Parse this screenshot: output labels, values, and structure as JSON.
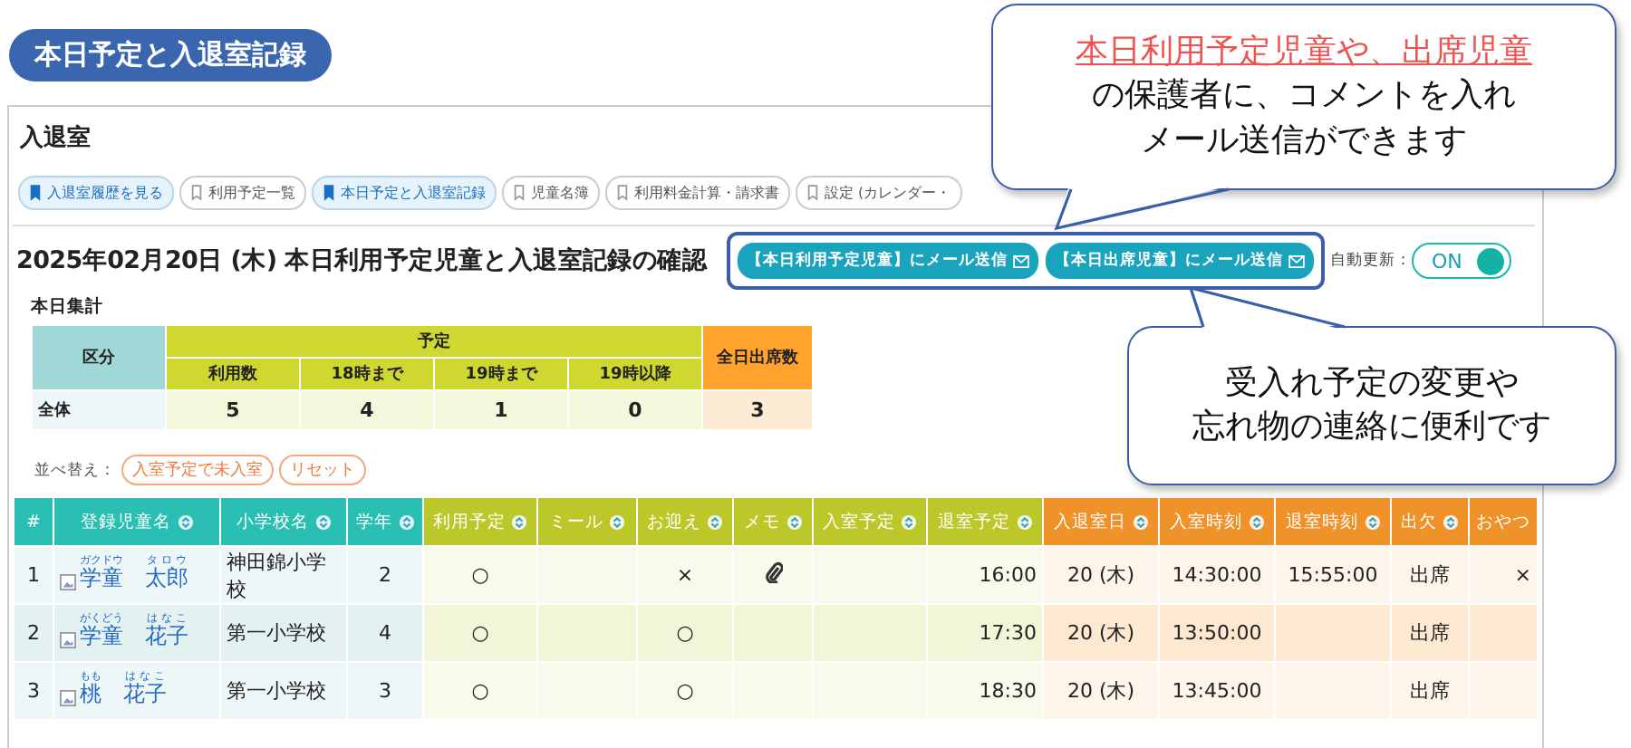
{
  "page_title": "本日予定と入退室記録",
  "panel": {
    "title": "入退室",
    "tabs": [
      {
        "label": "入退室履歴を見る",
        "selected": true
      },
      {
        "label": "利用予定一覧",
        "selected": false
      },
      {
        "label": "本日予定と入退室記録",
        "selected": true
      },
      {
        "label": "児童名簿",
        "selected": false
      },
      {
        "label": "利用料金計算・請求書",
        "selected": false
      },
      {
        "label": "設定 (カレンダー・",
        "selected": false
      }
    ],
    "heading": "2025年02月20日 (木) 本日利用予定児童と入退室記録の確認",
    "mail_buttons": [
      "【本日利用予定児童】にメール送信",
      "【本日出席児童】にメール送信"
    ],
    "auto_update": {
      "label": "自動更新：",
      "toggle_label": "ON",
      "on": true
    },
    "summary": {
      "title": "本日集計",
      "group_header": "区分",
      "plan_header": "予定",
      "plan_columns": [
        "利用数",
        "18時まで",
        "19時まで",
        "19時以降"
      ],
      "total_header": "全日出席数",
      "rows": [
        {
          "label": "全体",
          "values": [
            "5",
            "4",
            "1",
            "0"
          ],
          "total": "3"
        }
      ]
    },
    "sort": {
      "label": "並べ替え：",
      "buttons": [
        "入室予定で未入室",
        "リセット"
      ]
    },
    "table": {
      "columns": [
        {
          "label": "#",
          "color": "#2bbfb3",
          "sortable": false
        },
        {
          "label": "登録児童名",
          "color": "#2bbfb3",
          "sortable": true
        },
        {
          "label": "小学校名",
          "color": "#2bbfb3",
          "sortable": true
        },
        {
          "label": "学年",
          "color": "#2bbfb3",
          "sortable": true
        },
        {
          "label": "利用予定",
          "color": "#bcc72a",
          "sortable": true
        },
        {
          "label": "ミール",
          "color": "#bcc72a",
          "sortable": true
        },
        {
          "label": "お迎え",
          "color": "#bcc72a",
          "sortable": true
        },
        {
          "label": "メモ",
          "color": "#bcc72a",
          "sortable": true
        },
        {
          "label": "入室予定",
          "color": "#bcc72a",
          "sortable": true
        },
        {
          "label": "退室予定",
          "color": "#bcc72a",
          "sortable": true
        },
        {
          "label": "入退室日",
          "color": "#f0922a",
          "sortable": true
        },
        {
          "label": "入室時刻",
          "color": "#f0922a",
          "sortable": true
        },
        {
          "label": "退室時刻",
          "color": "#f0922a",
          "sortable": true
        },
        {
          "label": "出欠",
          "color": "#f0922a",
          "sortable": true
        },
        {
          "label": "おやつ",
          "color": "#f0922a",
          "sortable": false
        }
      ],
      "rows": [
        {
          "number": "1",
          "name": [
            {
              "text": "学童",
              "ruby": "ガクドウ"
            },
            {
              "text": "太郎",
              "ruby": "タロウ"
            }
          ],
          "school": "神田錦小学校",
          "grade": "2",
          "plan": "○",
          "meal": null,
          "pickup": "×",
          "memo_attached": true,
          "entry_plan": null,
          "exit_plan": "16:00",
          "date": "20 (木)",
          "entry_time": "14:30:00",
          "exit_time": "15:55:00",
          "attendance": "出席",
          "snack": "×"
        },
        {
          "number": "2",
          "name": [
            {
              "text": "学童",
              "ruby": "がくどう"
            },
            {
              "text": "花子",
              "ruby": "はなこ"
            }
          ],
          "school": "第一小学校",
          "grade": "4",
          "plan": "○",
          "meal": null,
          "pickup": "○",
          "memo_attached": false,
          "entry_plan": null,
          "exit_plan": "17:30",
          "date": "20 (木)",
          "entry_time": "13:50:00",
          "exit_time": null,
          "attendance": "出席",
          "snack": null
        },
        {
          "number": "3",
          "name": [
            {
              "text": "桃",
              "ruby": "もも"
            },
            {
              "text": "花子",
              "ruby": "はなこ"
            }
          ],
          "school": "第一小学校",
          "grade": "3",
          "plan": "○",
          "meal": null,
          "pickup": "○",
          "memo_attached": false,
          "entry_plan": null,
          "exit_plan": "18:30",
          "date": "20 (木)",
          "entry_time": "13:45:00",
          "exit_time": null,
          "attendance": "出席",
          "snack": null
        }
      ]
    }
  },
  "callouts": [
    {
      "lines": [
        {
          "text": "本日利用予定児童や、出席児童",
          "kind": "highlight"
        },
        {
          "text": "の保護者に、コメントを入れ",
          "kind": "plain"
        },
        {
          "text": "メール送信ができます",
          "kind": "plain"
        }
      ]
    },
    {
      "lines": [
        {
          "text": "受入れ予定の変更や",
          "kind": "plain"
        },
        {
          "text": "忘れ物の連絡に便利です",
          "kind": "plain"
        }
      ]
    }
  ]
}
